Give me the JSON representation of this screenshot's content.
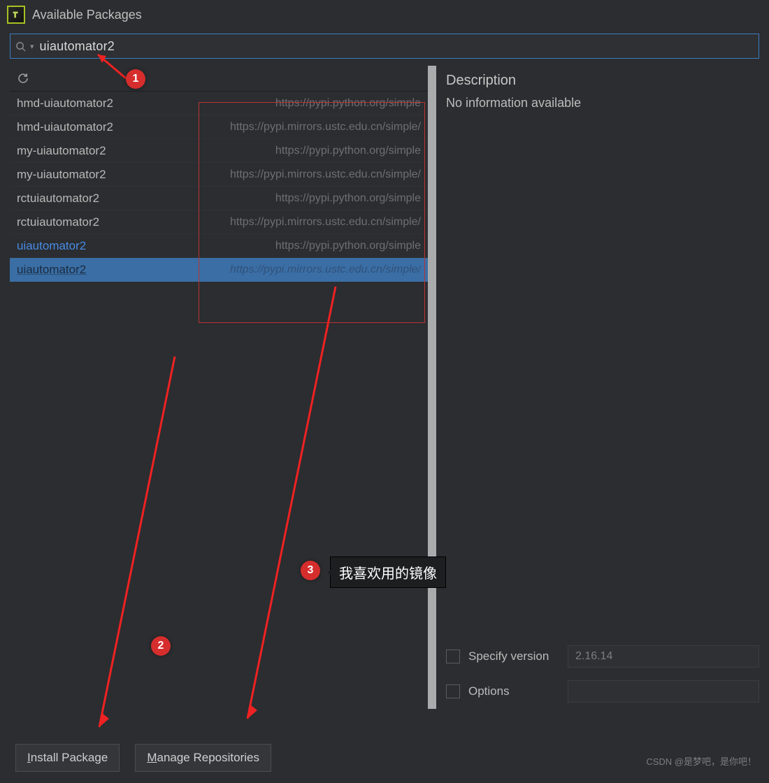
{
  "window": {
    "title": "Available Packages"
  },
  "search": {
    "value": "uiautomator2"
  },
  "packages": [
    {
      "name": "hmd-uiautomator2",
      "repo": "https://pypi.python.org/simple",
      "blue": false,
      "selected": false
    },
    {
      "name": "hmd-uiautomator2",
      "repo": "https://pypi.mirrors.ustc.edu.cn/simple/",
      "blue": false,
      "selected": false
    },
    {
      "name": "my-uiautomator2",
      "repo": "https://pypi.python.org/simple",
      "blue": false,
      "selected": false
    },
    {
      "name": "my-uiautomator2",
      "repo": "https://pypi.mirrors.ustc.edu.cn/simple/",
      "blue": false,
      "selected": false
    },
    {
      "name": "rctuiautomator2",
      "repo": "https://pypi.python.org/simple",
      "blue": false,
      "selected": false
    },
    {
      "name": "rctuiautomator2",
      "repo": "https://pypi.mirrors.ustc.edu.cn/simple/",
      "blue": false,
      "selected": false
    },
    {
      "name": "uiautomator2",
      "repo": "https://pypi.python.org/simple",
      "blue": true,
      "selected": false
    },
    {
      "name": "uiautomator2",
      "repo": "https://pypi.mirrors.ustc.edu.cn/simple/",
      "blue": true,
      "selected": true
    }
  ],
  "description": {
    "heading": "Description",
    "body": "No information available"
  },
  "form": {
    "specify_version": {
      "label": "Specify version",
      "value": "2.16.14",
      "checked": false
    },
    "options": {
      "label": "Options",
      "value": "",
      "checked": false
    }
  },
  "buttons": {
    "install": "Install Package",
    "manage": "Manage Repositories"
  },
  "annotations": {
    "b1": "1",
    "b2": "2",
    "b3": "3",
    "callout3": "我喜欢用的镜像"
  },
  "watermark": "CSDN @是梦吧，是你吧！"
}
